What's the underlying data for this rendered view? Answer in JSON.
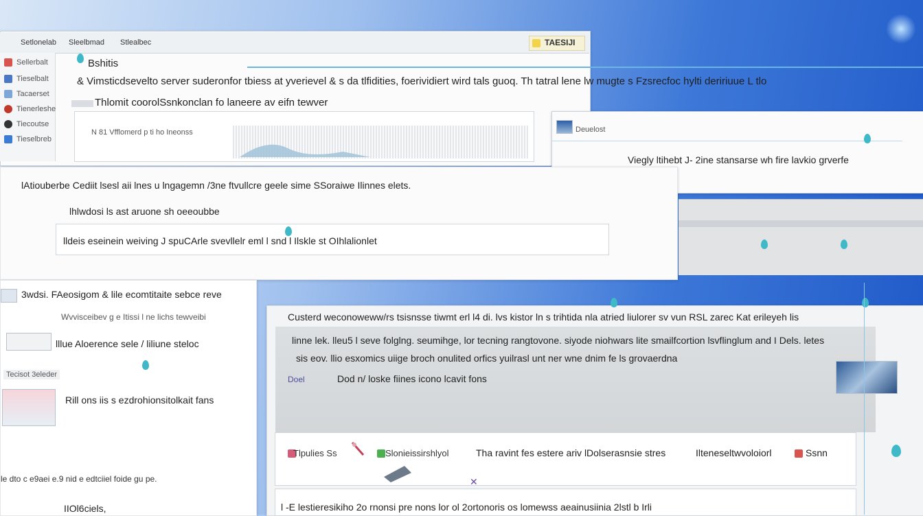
{
  "toolbar": {
    "tabs": [
      "Setlonelab",
      "Sleelbmad",
      "Stlealbec"
    ],
    "badge_label": "TAESIJI"
  },
  "sidebar": {
    "items": [
      "Sellerbalt",
      "Tieselbalt",
      "Tacaerset",
      "Tienerleshe",
      "Tiecoutse",
      "Tieselbreb"
    ]
  },
  "header": {
    "title": "Bshitis",
    "description": "& Vimsticdsevelto server suderonfor tbiess at yverievel & s da tlfidities, foerividiert wird tals guoq. Th tatral lene lw mugte s Fzsrecfoc hylti deririuue L tlo",
    "subtitle": "Thlomit coorolSsnkonclan fo laneere av eifn tewver",
    "caption": "N 81 Vfflomerd p ti ho Ineonss"
  },
  "right_top_panel": {
    "text": "Viegly ltihebt J- 2ine stansarse wh fire lavkio grverfe",
    "thumb_label": "Deuelost"
  },
  "band": {
    "heading": "lAtiouberbe Cediit lsesl aii lnes u lngagemn /3ne ftvullcre geele sime SSoraiwe Ilinnes elets.",
    "label": "lhlwdosi ls ast aruone sh oeeoubbe",
    "field_text": "lldeis eseinein weiving J spuCArle svevllelr eml  l   snd l  Ilskle st  OIhlalionlet"
  },
  "section2": {
    "heading": "3wdsi.   FAeosigom & lile ecomtitaite sebce reve",
    "sub": "Wvvisceibev  g e  Itissi   l ne lichs tewveibi",
    "caption": "lllue Aloerence sele / liliune steloc"
  },
  "left_lower": {
    "row_label": "Rill ons iis s ezdrohionsitolkait fans",
    "footer_line": "le dto c e9aei e.9 nid e  edtciiel foide  gu pe.",
    "last_item": "IIOl6ciels,",
    "panel_tab": "Tecisot 3eleder"
  },
  "main_panel": {
    "heading": "Custerd  weconoweww/rs tsisnsse tiwmt erl l4 di. lvs kistor ln s trihtida nla atried liulorer sv vun  RSL zarec Kat  erileyeh lis",
    "para1": "linne lek. lleu5 l seve folglng. seumihge, lor tecning rangtovone. siyode niohwars lite smailfcortion lsvflinglum  and I Dels. letes",
    "para2": "sis eov. llio esxomics uiige broch onulited orfics yuilrasl unt  ner wne dnim fe  ls grovaerdna",
    "link_label": "Doel",
    "link_text": "Dod n/ loske  fiines icono lcavit fons"
  },
  "bottom_panel": {
    "items": [
      "Tlpulies Ss",
      "Slonieissirshlyol",
      "Tha ravint fes estere ariv lDolserasnsie stres",
      "Ilteneseltwvoloiorl",
      "Ssnn"
    ],
    "row2": "l -E lestieresikiho 2o rnonsi pre nons lor ol 2ortonoris os lomewss aeainusiinia 2lstl b Irli"
  },
  "icons": [
    "app-icon",
    "drop-marker-icon",
    "close-icon",
    "folder-icon"
  ],
  "colors": {
    "desktop_accent": "#1e58c8",
    "glow_line": "#6bb5e3",
    "badge": "#f3d34a"
  }
}
